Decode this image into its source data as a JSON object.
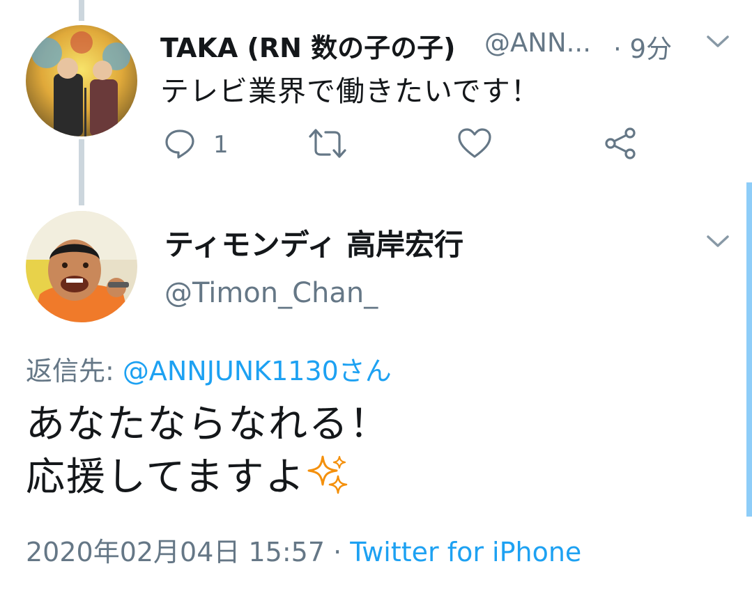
{
  "tweet1": {
    "name": "TAKA (RN 数の子の子)",
    "handle": "@ANN...",
    "separator_time": " · 9分",
    "text": "テレビ業界で働きたいです！",
    "reply_count": "1",
    "icons": [
      "reply-icon",
      "retweet-icon",
      "like-icon",
      "share-icon",
      "chevron-down-icon"
    ]
  },
  "tweet2": {
    "name": "ティモンディ 高岸宏行",
    "handle": "@Timon_Chan_",
    "reply_prefix": "返信先: ",
    "reply_mention": "@ANNJUNK1130さん",
    "body_line1": "あなたならなれる！",
    "body_line2": "応援してますよ",
    "emoji": "sparkles",
    "timestamp": "2020年02月04日 15:57",
    "meta_separator": " · ",
    "source": "Twitter for iPhone"
  },
  "colors": {
    "text": "#14171a",
    "secondary": "#657786",
    "link": "#1da1f2",
    "thread_line": "#ccd6dd",
    "focus_bar": "#8ecdf8",
    "sparkle": "#f4900c"
  }
}
